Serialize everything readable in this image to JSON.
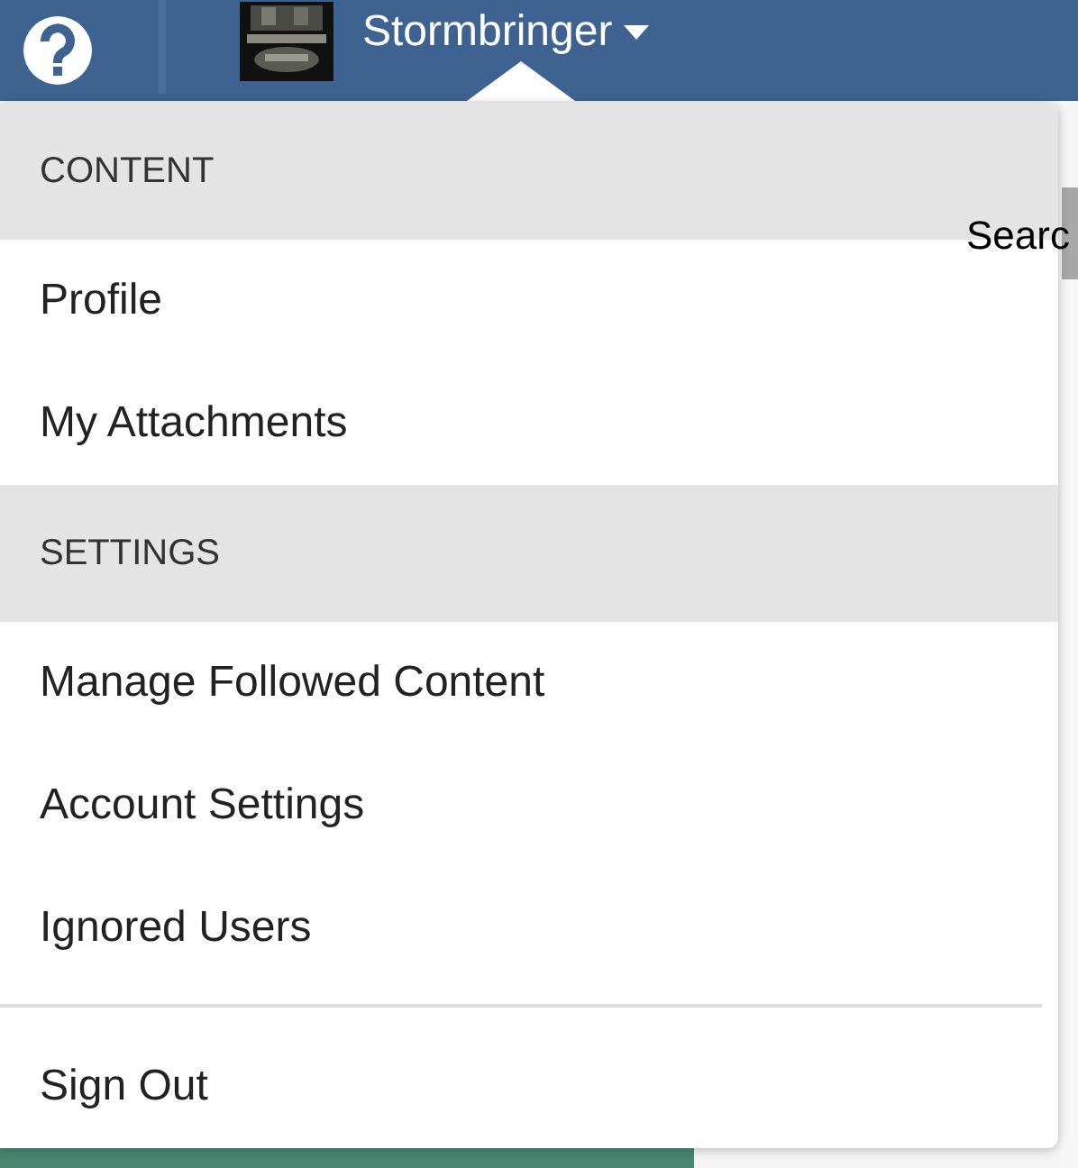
{
  "header": {
    "username": "Stormbringer",
    "menu_open": true
  },
  "page": {
    "search_label": "Searc"
  },
  "menu": [
    {
      "kind": "heading",
      "label": "CONTENT"
    },
    {
      "kind": "item",
      "label": "Profile"
    },
    {
      "kind": "item",
      "label": "My Attachments"
    },
    {
      "kind": "heading",
      "label": "SETTINGS"
    },
    {
      "kind": "item",
      "label": "Manage Followed Content"
    },
    {
      "kind": "item",
      "label": "Account Settings"
    },
    {
      "kind": "item",
      "label": "Ignored Users"
    },
    {
      "kind": "divider"
    },
    {
      "kind": "item",
      "label": "Sign Out"
    }
  ]
}
